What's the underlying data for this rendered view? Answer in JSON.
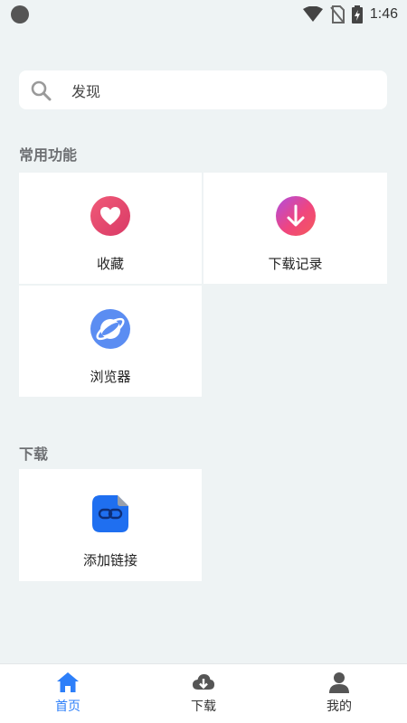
{
  "status_bar": {
    "time": "1:46"
  },
  "search": {
    "placeholder": "发现"
  },
  "sections": {
    "common": {
      "title": "常用功能",
      "items": [
        {
          "label": "收藏",
          "icon": "heart-icon",
          "color": "#e8456b"
        },
        {
          "label": "下载记录",
          "icon": "download-arrow-icon",
          "color": "#ee3e84"
        },
        {
          "label": "浏览器",
          "icon": "browser-planet-icon",
          "color": "#5b8df2"
        }
      ]
    },
    "download": {
      "title": "下载",
      "items": [
        {
          "label": "添加链接",
          "icon": "link-icon",
          "color": "#1f6ff0"
        }
      ]
    }
  },
  "bottom_nav": {
    "items": [
      {
        "label": "首页",
        "icon": "home-icon",
        "active": true
      },
      {
        "label": "下载",
        "icon": "cloud-download-icon",
        "active": false
      },
      {
        "label": "我的",
        "icon": "user-icon",
        "active": false
      }
    ]
  },
  "colors": {
    "accent": "#2d7ff9",
    "background": "#eef3f4"
  }
}
